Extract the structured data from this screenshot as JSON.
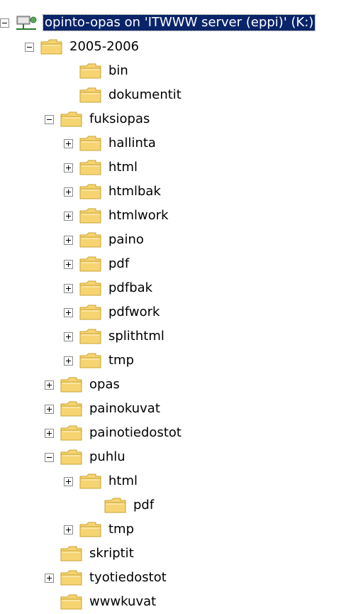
{
  "root": {
    "label": "opinto-opas on 'ITWWW server (eppi)' (K:)",
    "icon": "network-drive-icon",
    "expanded": true,
    "selected": true
  },
  "folders": [
    {
      "label": "2005-2006",
      "toggle": "minus"
    },
    {
      "label": "bin",
      "toggle": "none"
    },
    {
      "label": "dokumentit",
      "toggle": "none"
    },
    {
      "label": "fuksiopas",
      "toggle": "minus"
    },
    {
      "label": "hallinta",
      "toggle": "plus"
    },
    {
      "label": "html",
      "toggle": "plus"
    },
    {
      "label": "htmlbak",
      "toggle": "plus"
    },
    {
      "label": "htmlwork",
      "toggle": "plus"
    },
    {
      "label": "paino",
      "toggle": "plus"
    },
    {
      "label": "pdf",
      "toggle": "plus"
    },
    {
      "label": "pdfbak",
      "toggle": "plus"
    },
    {
      "label": "pdfwork",
      "toggle": "plus"
    },
    {
      "label": "splithtml",
      "toggle": "plus"
    },
    {
      "label": "tmp",
      "toggle": "plus"
    },
    {
      "label": "opas",
      "toggle": "plus"
    },
    {
      "label": "painokuvat",
      "toggle": "plus"
    },
    {
      "label": "painotiedostot",
      "toggle": "plus"
    },
    {
      "label": "puhlu",
      "toggle": "minus"
    },
    {
      "label": "html",
      "toggle": "plus"
    },
    {
      "label": "pdf",
      "toggle": "none"
    },
    {
      "label": "tmp",
      "toggle": "plus"
    },
    {
      "label": "skriptit",
      "toggle": "none"
    },
    {
      "label": "tyotiedostot",
      "toggle": "plus"
    },
    {
      "label": "wwwkuvat",
      "toggle": "none"
    }
  ],
  "colors": {
    "selection": "#0a246a",
    "folder_fill": "#f6d472",
    "folder_outline": "#c9a331"
  }
}
